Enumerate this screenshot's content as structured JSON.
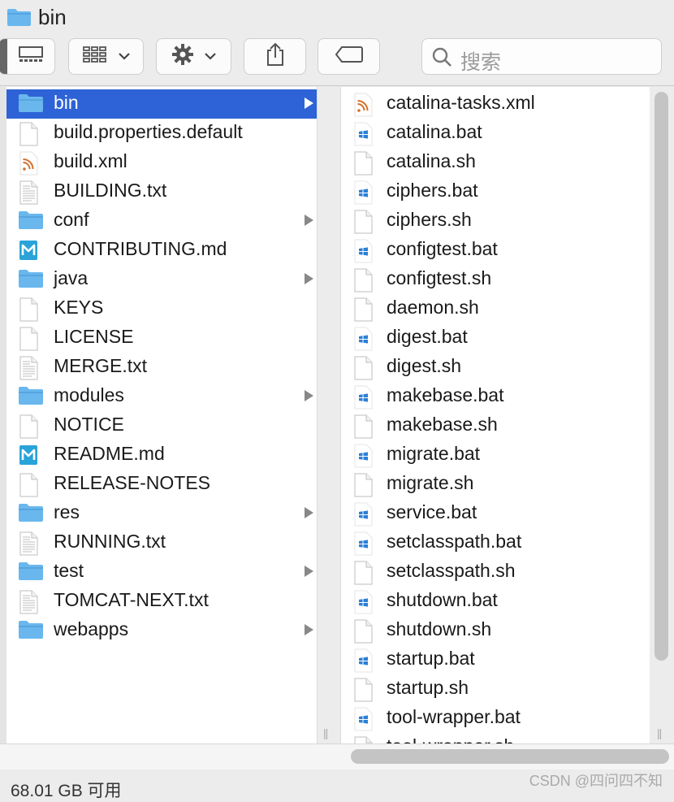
{
  "window": {
    "title": "bin",
    "title_icon": "folder-icon"
  },
  "toolbar": {
    "view_buttons": [
      "column-view-icon",
      "gallery-view-icon"
    ],
    "group_icon": "grid-icon",
    "action_icon": "gear-icon",
    "share_icon": "share-icon",
    "tag_icon": "tag-icon",
    "search": {
      "placeholder": "搜索",
      "icon": "search-icon"
    }
  },
  "column1": {
    "items": [
      {
        "name": "bin",
        "type": "folder",
        "selected": true,
        "has_children": true
      },
      {
        "name": "build.properties.default",
        "type": "file"
      },
      {
        "name": "build.xml",
        "type": "xml"
      },
      {
        "name": "BUILDING.txt",
        "type": "text"
      },
      {
        "name": "conf",
        "type": "folder",
        "has_children": true
      },
      {
        "name": "CONTRIBUTING.md",
        "type": "markdown"
      },
      {
        "name": "java",
        "type": "folder",
        "has_children": true
      },
      {
        "name": "KEYS",
        "type": "file"
      },
      {
        "name": "LICENSE",
        "type": "file"
      },
      {
        "name": "MERGE.txt",
        "type": "text"
      },
      {
        "name": "modules",
        "type": "folder",
        "has_children": true
      },
      {
        "name": "NOTICE",
        "type": "file"
      },
      {
        "name": "README.md",
        "type": "markdown"
      },
      {
        "name": "RELEASE-NOTES",
        "type": "file"
      },
      {
        "name": "res",
        "type": "folder",
        "has_children": true
      },
      {
        "name": "RUNNING.txt",
        "type": "text"
      },
      {
        "name": "test",
        "type": "folder",
        "has_children": true
      },
      {
        "name": "TOMCAT-NEXT.txt",
        "type": "text"
      },
      {
        "name": "webapps",
        "type": "folder",
        "has_children": true
      }
    ]
  },
  "column2": {
    "items": [
      {
        "name": "catalina-tasks.xml",
        "type": "xml"
      },
      {
        "name": "catalina.bat",
        "type": "bat"
      },
      {
        "name": "catalina.sh",
        "type": "file"
      },
      {
        "name": "ciphers.bat",
        "type": "bat"
      },
      {
        "name": "ciphers.sh",
        "type": "file"
      },
      {
        "name": "configtest.bat",
        "type": "bat"
      },
      {
        "name": "configtest.sh",
        "type": "file"
      },
      {
        "name": "daemon.sh",
        "type": "file"
      },
      {
        "name": "digest.bat",
        "type": "bat"
      },
      {
        "name": "digest.sh",
        "type": "file"
      },
      {
        "name": "makebase.bat",
        "type": "bat"
      },
      {
        "name": "makebase.sh",
        "type": "file"
      },
      {
        "name": "migrate.bat",
        "type": "bat"
      },
      {
        "name": "migrate.sh",
        "type": "file"
      },
      {
        "name": "service.bat",
        "type": "bat"
      },
      {
        "name": "setclasspath.bat",
        "type": "bat"
      },
      {
        "name": "setclasspath.sh",
        "type": "file"
      },
      {
        "name": "shutdown.bat",
        "type": "bat"
      },
      {
        "name": "shutdown.sh",
        "type": "file"
      },
      {
        "name": "startup.bat",
        "type": "bat"
      },
      {
        "name": "startup.sh",
        "type": "file"
      },
      {
        "name": "tool-wrapper.bat",
        "type": "bat"
      },
      {
        "name": "tool-wrapper.sh",
        "type": "file"
      }
    ]
  },
  "status": {
    "text": "68.01 GB 可用"
  },
  "watermark": "CSDN @四问四不知",
  "colors": {
    "selection": "#2d63d6",
    "folder": "#6ab7ee",
    "rss": "#d4702b",
    "windows": "#2b7fd4",
    "markdown": "#2aa3d8"
  }
}
